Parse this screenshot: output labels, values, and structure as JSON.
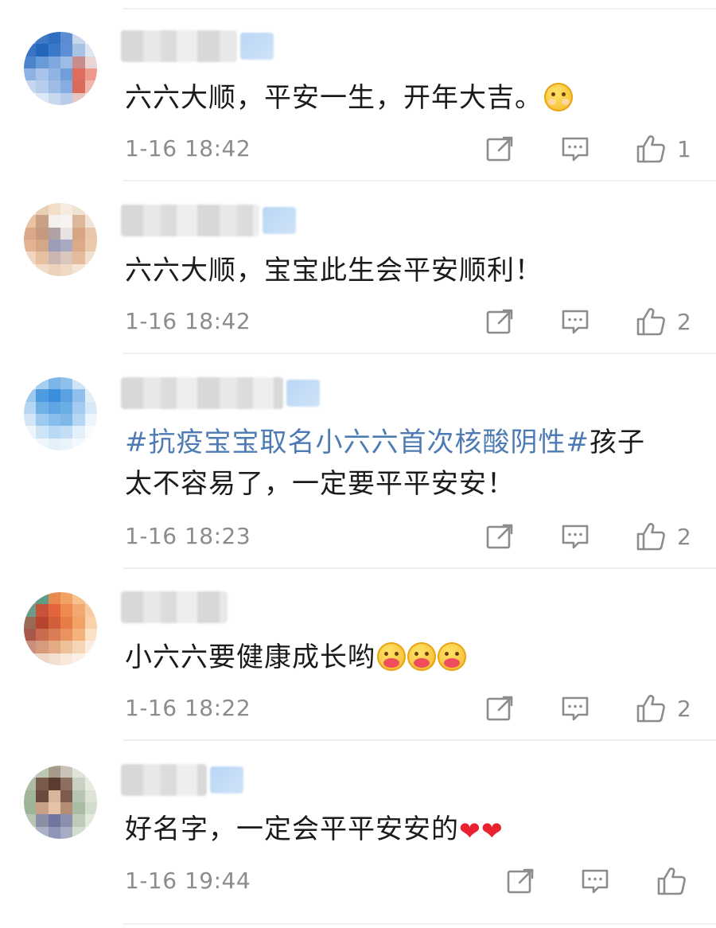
{
  "comments": [
    {
      "text": "六六大顺，平安一生，开年大吉。",
      "emoji": "shy-face-emoji",
      "time": "1-16 18:42",
      "likes": "1"
    },
    {
      "text": "六六大顺，宝宝此生会平安顺利！",
      "time": "1-16 18:42",
      "likes": "2"
    },
    {
      "hashtag": "#抗疫宝宝取名小六六首次核酸阴性#",
      "text_line1": "孩子",
      "text_line2": "太不容易了，一定要平平安安！",
      "time": "1-16 18:23",
      "likes": "2"
    },
    {
      "text": "小六六要健康成长哟",
      "emoji": "hug-face-emoji",
      "time": "1-16 18:22",
      "likes": "2"
    },
    {
      "text": "好名字，一定会平平安安的",
      "emoji": "red-heart-emoji",
      "heart_glyph": "❤",
      "time": "1-16 19:44",
      "likes": ""
    }
  ],
  "colors": {
    "hashtag": "#4e7bb3",
    "meta": "#8c8c8c",
    "heart": "#e8222f"
  },
  "icons": [
    "share-icon",
    "reply-icon",
    "like-icon"
  ]
}
